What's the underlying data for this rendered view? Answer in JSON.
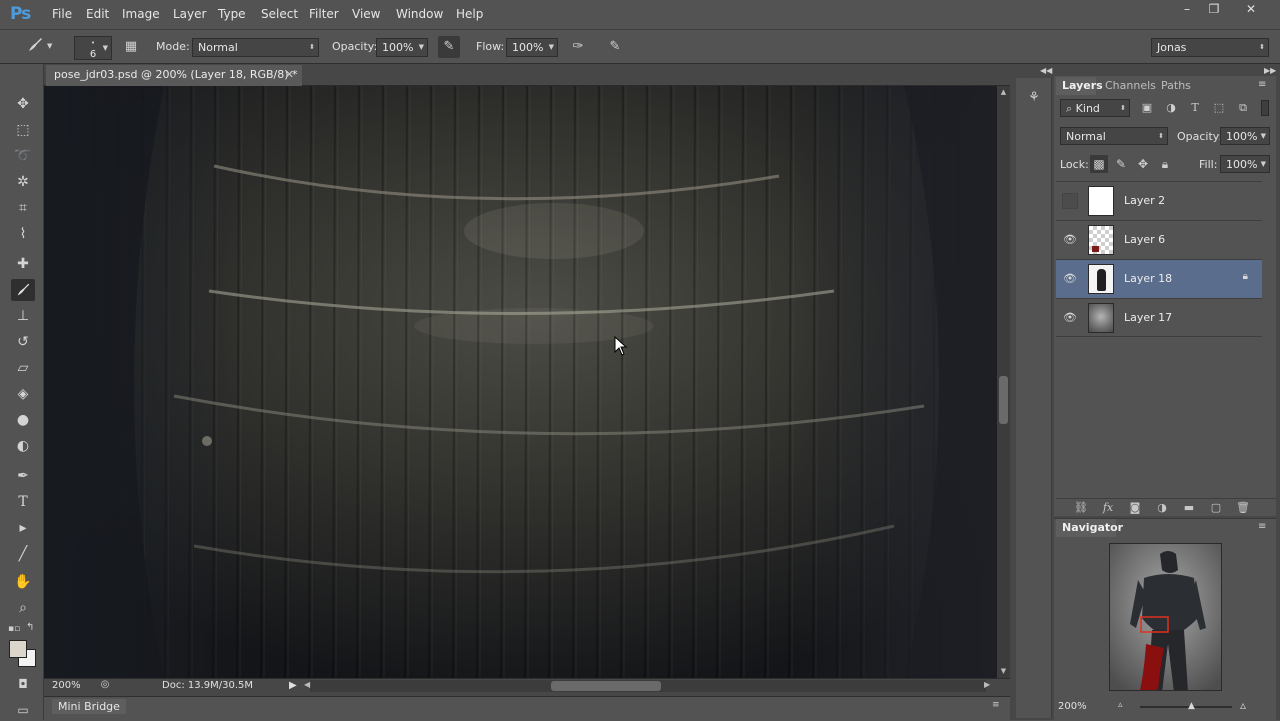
{
  "app": {
    "logo": "Ps"
  },
  "menu": [
    "File",
    "Edit",
    "Image",
    "Layer",
    "Type",
    "Select",
    "Filter",
    "View",
    "Window",
    "Help"
  ],
  "window_controls": [
    "–",
    "❐",
    "✕"
  ],
  "options": {
    "brush_size": "6",
    "mode_label": "Mode:",
    "mode_value": "Normal",
    "opacity_label": "Opacity:",
    "opacity_value": "100%",
    "flow_label": "Flow:",
    "flow_value": "100%",
    "workspace": "Jonas"
  },
  "document": {
    "tab_title": "pose_jdr03.psd @ 200% (Layer 18, RGB/8) *",
    "zoom": "200%",
    "doc_size": "Doc: 13.9M/30.5M"
  },
  "mini_bridge": "Mini Bridge",
  "layers_panel": {
    "tabs": [
      "Layers",
      "Channels",
      "Paths"
    ],
    "filter_kind": "Kind",
    "blend_mode": "Normal",
    "opacity_label": "Opacity:",
    "opacity_value": "100%",
    "lock_label": "Lock:",
    "fill_label": "Fill:",
    "fill_value": "100%",
    "layers": [
      {
        "name": "Layer 2",
        "visible": false,
        "selected": false,
        "locked": false
      },
      {
        "name": "Layer 6",
        "visible": true,
        "selected": false,
        "locked": false
      },
      {
        "name": "Layer 18",
        "visible": true,
        "selected": true,
        "locked": true
      },
      {
        "name": "Layer 17",
        "visible": true,
        "selected": false,
        "locked": false
      }
    ]
  },
  "navigator": {
    "title": "Navigator",
    "zoom": "200%"
  },
  "colors": {
    "ui_bg": "#535353",
    "selection": "#5a6d8c",
    "nav_view_box": "#e0301e",
    "ps_blue": "#4f9bd9"
  }
}
